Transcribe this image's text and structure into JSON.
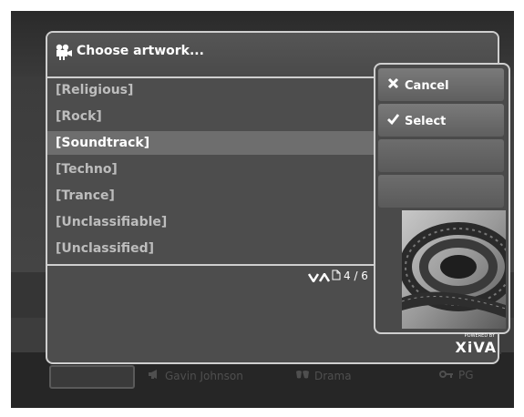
{
  "dialog": {
    "title": "Choose artwork...",
    "icon": "film-camera-icon",
    "items": [
      {
        "label": "[Religious]",
        "selected": false
      },
      {
        "label": "[Rock]",
        "selected": false
      },
      {
        "label": "[Soundtrack]",
        "selected": true
      },
      {
        "label": "[Techno]",
        "selected": false
      },
      {
        "label": "[Trance]",
        "selected": false
      },
      {
        "label": "[Unclassifiable]",
        "selected": false
      },
      {
        "label": "[Unclassified]",
        "selected": false
      }
    ],
    "pager": {
      "text": "4 / 6",
      "icons": [
        "arrow-down-icon",
        "arrow-up-icon",
        "page-icon"
      ]
    }
  },
  "actions": {
    "cancel": {
      "label": "Cancel",
      "icon": "x-icon"
    },
    "select": {
      "label": "Select",
      "icon": "checkmark-icon"
    }
  },
  "background_meta": {
    "director": "Gavin Johnson",
    "genre": "Drama",
    "rating": "PG"
  },
  "branding": {
    "powered_by": "POWERED BY",
    "logo_text": "XiVA"
  },
  "colors": {
    "dialog_bg": "#4d4d4d",
    "border": "#cfcfcf",
    "selected_row": "#6e6e6e",
    "text_muted": "#bdbdbd",
    "text_bright": "#ffffff"
  }
}
